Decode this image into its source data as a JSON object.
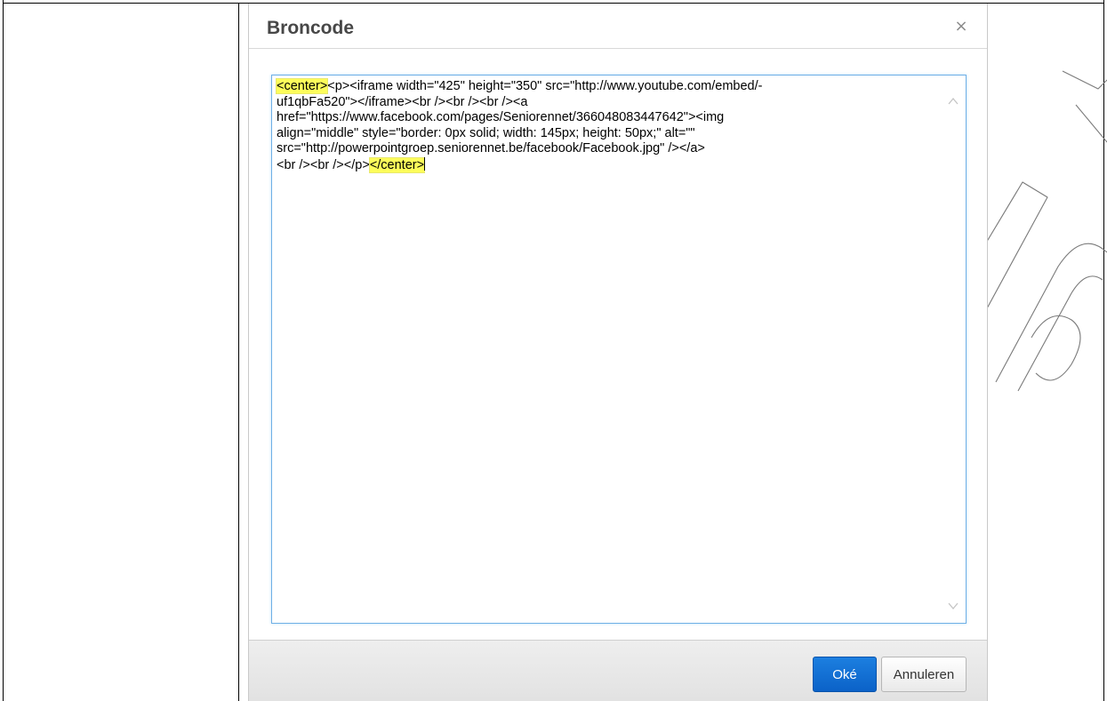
{
  "dialog": {
    "title": "Broncode",
    "close_label": "×"
  },
  "source": {
    "lines": [
      {
        "hl_before": "<center>",
        "text": "<p><iframe width=\"425\" height=\"350\" src=\"http://www.youtube.com/embed/-",
        "hl_after": ""
      },
      {
        "hl_before": "",
        "text": "uf1qbFa520\"></iframe><br /><br /><br /><a",
        "hl_after": ""
      },
      {
        "hl_before": "",
        "text": "href=\"https://www.facebook.com/pages/Seniorennet/366048083447642\"><img",
        "hl_after": ""
      },
      {
        "hl_before": "",
        "text": "align=\"middle\" style=\"border: 0px solid; width: 145px; height: 50px;\" alt=\"\"",
        "hl_after": ""
      },
      {
        "hl_before": "",
        "text": "src=\"http://powerpointgroep.seniorennet.be/facebook/Facebook.jpg\" /></a>",
        "hl_after": ""
      },
      {
        "hl_before": "",
        "text": "<br /><br /></p>",
        "hl_after": "</center>"
      }
    ]
  },
  "footer": {
    "ok_label": "Oké",
    "cancel_label": "Annuleren"
  },
  "colors": {
    "highlight": "#fdfd5a",
    "ok_button": "#0b62c8",
    "textarea_border": "#6fb0e6"
  },
  "icons": {
    "scroll_up": "chevron-up-icon",
    "scroll_down": "chevron-down-icon",
    "close": "close-icon"
  }
}
